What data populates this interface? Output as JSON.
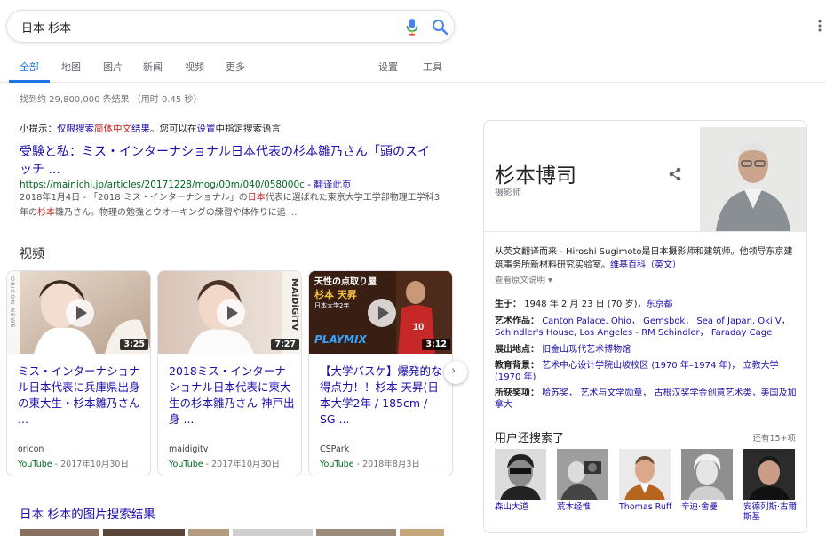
{
  "search": {
    "query": "日本 杉本"
  },
  "tabs": {
    "all": "全部",
    "maps": "地图",
    "images": "图片",
    "news": "新闻",
    "videos": "视频",
    "more": "更多",
    "settings": "设置",
    "tools": "工具"
  },
  "stats": "找到约 29,800,000 条结果 （用时 0.45 秒）",
  "tip": {
    "prefix": "小提示：",
    "part1": "仅限搜索",
    "part2": "简体中文",
    "part3": "结果",
    "part4": "。您可以在",
    "part5": "设置",
    "part6": "中指定搜索语言"
  },
  "result": {
    "title": "受験と私：ミス・インターナショナル日本代表の杉本雛乃さん「頭のスイッチ ...",
    "url": "https://mainichi.jp/articles/20171228/mog/00m/040/058000c",
    "translate": " - 翻译此页",
    "snippet_a": "2018年1月4日 - 「2018 ミス・インターナショナル」の",
    "snippet_b": "日本",
    "snippet_c": "代表に選ばれた東京大学工学部物理工学科3年の",
    "snippet_d": "杉本",
    "snippet_e": "雛乃さん。物理の勉強とウオーキングの練習や体作りに追 ..."
  },
  "videos": {
    "heading": "视频",
    "items": [
      {
        "title": "ミス・インターナショナル日本代表に兵庫県出身の東大生・杉本雛乃さん ...",
        "source": "oricon",
        "platform": "YouTube",
        "date": " - 2017年10月30日",
        "duration": "3:25",
        "watermark": "ORICON NEWS"
      },
      {
        "title": "2018ミス・インターナショナル日本代表に東大生の杉本雛乃さん 神戸出身 ...",
        "source": "maidigitv",
        "platform": "YouTube",
        "date": " - 2017年10月30日",
        "duration": "7:27",
        "watermark": "MAiDiGiTV"
      },
      {
        "title": "【大学バスケ】爆発的な得点力！！杉本 天昇(日本大学2年 / 185cm / SG ...",
        "source": "CSPark",
        "platform": "YouTube",
        "date": " - 2018年8月3日",
        "duration": "3:12",
        "overlay_line1": "天性の点取り屋",
        "overlay_line2": "杉本 天昇",
        "overlay_line3": "日本大学2年",
        "overlay_brand": "PLAYMIX"
      }
    ]
  },
  "images_heading": "日本 杉本的图片搜索结果",
  "knowledge": {
    "name": "杉本博司",
    "subtitle": "摄影师",
    "description": "从英文翻译而来 - Hiroshi Sugimoto是日本摄影师和建筑师。他领导东京建筑事务所新材料研究实验室。",
    "source": "维基百科（英文）",
    "more_text": "查看原文说明 ▾",
    "facts": [
      {
        "label": "生于：",
        "text": "1948 年 2 月 23 日 (70 岁)，",
        "link": "东京都"
      },
      {
        "label": "艺术作品：",
        "text": "",
        "link": "Canton Palace, Ohio， Gemsbok， Sea of Japan, Oki V， Schindler's House, Los Angeles - RM Schindler， Faraday Cage"
      },
      {
        "label": "展出地点：",
        "text": "",
        "link": "旧金山现代艺术博物馆"
      },
      {
        "label": "教育背景：",
        "text": "",
        "link": "艺术中心设计学院山坡校区 (1970 年–1974 年)， 立教大学 (1970 年)"
      },
      {
        "label": "所获奖项：",
        "text": "",
        "link": "哈苏奖， 艺术与文学勋章， 古根汉奖学金创意艺术类，美国及加拿大"
      }
    ],
    "also_heading": "用户还搜索了",
    "also_more": "还有15+项",
    "people": [
      {
        "name": "森山大道"
      },
      {
        "name": "荒木经惟"
      },
      {
        "name": "Thomas Ruff"
      },
      {
        "name": "辛迪·舍曼"
      },
      {
        "name": "安德列斯·古爾斯基"
      }
    ]
  },
  "colors": {
    "link": "#1a0dab",
    "url_green": "#006621",
    "accent_blue": "#1a73e8",
    "highlight_red": "#c5221f"
  }
}
